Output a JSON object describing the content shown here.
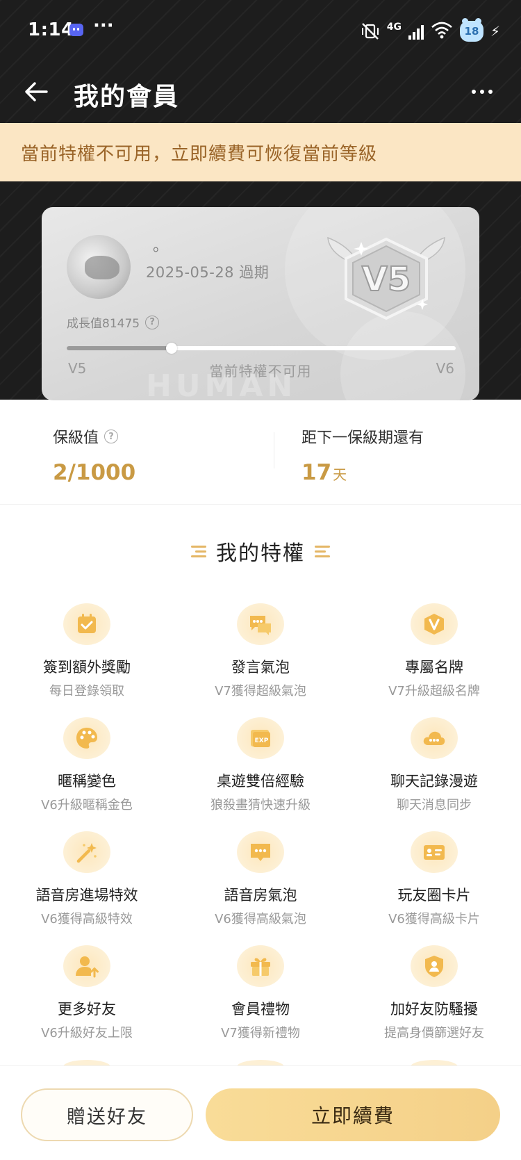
{
  "status_bar": {
    "time": "1:14",
    "dots": "···",
    "network": "4G",
    "battery": "18"
  },
  "app_bar": {
    "title": "我的會員"
  },
  "notice": {
    "text": "當前特權不可用，立即續費可恢復當前等級"
  },
  "member_card": {
    "name": "。",
    "expiry": "2025-05-28 過期",
    "growth_label": "成長值81475",
    "current_level": "V5",
    "next_level": "V6",
    "status_text": "當前特權不可用",
    "badge_text": "V5",
    "progress_fraction": 0.27,
    "watermark": "HUMAN"
  },
  "stats": {
    "keep_label": "保級值",
    "keep_value": "2/1000",
    "remain_label": "距下一保級期還有",
    "remain_value": "17",
    "remain_unit": "天"
  },
  "privileges": {
    "title": "我的特權",
    "items": [
      {
        "name": "簽到額外獎勵",
        "desc": "每日登錄領取",
        "icon": "calendar-check-icon"
      },
      {
        "name": "發言氣泡",
        "desc": "V7獲得超級氣泡",
        "icon": "chat-bubbles-icon"
      },
      {
        "name": "專屬名牌",
        "desc": "V7升級超級名牌",
        "icon": "v-shield-icon"
      },
      {
        "name": "暱稱變色",
        "desc": "V6升級暱稱金色",
        "icon": "palette-icon"
      },
      {
        "name": "桌遊雙倍經驗",
        "desc": "狼殺畫猜快速升級",
        "icon": "exp-card-icon"
      },
      {
        "name": "聊天記錄漫遊",
        "desc": "聊天消息同步",
        "icon": "cloud-chat-icon"
      },
      {
        "name": "語音房進場特效",
        "desc": "V6獲得高級特效",
        "icon": "magic-wand-icon"
      },
      {
        "name": "語音房氣泡",
        "desc": "V6獲得高級氣泡",
        "icon": "message-bubble-icon"
      },
      {
        "name": "玩友圈卡片",
        "desc": "V6獲得高級卡片",
        "icon": "id-card-icon"
      },
      {
        "name": "更多好友",
        "desc": "V6升級好友上限",
        "icon": "user-up-icon"
      },
      {
        "name": "會員禮物",
        "desc": "V7獲得新禮物",
        "icon": "gift-icon"
      },
      {
        "name": "加好友防騷擾",
        "desc": "提高身價篩選好友",
        "icon": "shield-user-icon"
      }
    ]
  },
  "bottom_bar": {
    "gift_label": "贈送好友",
    "renew_label": "立即續費"
  },
  "colors": {
    "gold": "#c99a44",
    "banner_bg": "#fbe6c4",
    "banner_text": "#9a6428",
    "renew_bg": "#f6d48e"
  }
}
